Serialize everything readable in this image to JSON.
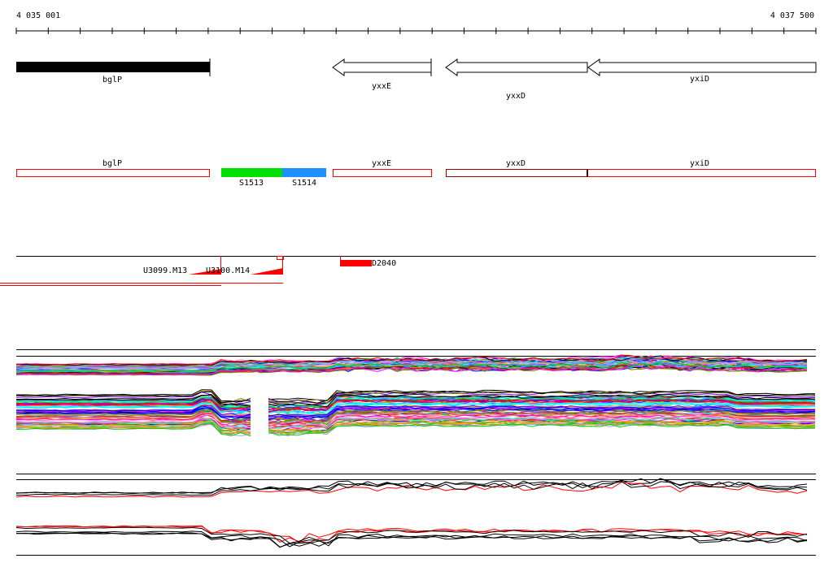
{
  "ruler": {
    "start_label": "4 035 001",
    "end_label": "4 037 500"
  },
  "genes": [
    {
      "name": "bglP",
      "strand": "+",
      "highlight": true
    },
    {
      "name": "yxxE",
      "strand": "-"
    },
    {
      "name": "yxxD",
      "strand": "-"
    },
    {
      "name": "yxiD",
      "strand": "-"
    }
  ],
  "segments": [
    {
      "name": "S1513",
      "color": "#00e000"
    },
    {
      "name": "S1514",
      "color": "#1e90ff"
    }
  ],
  "features": [
    {
      "name": "U3099.M13"
    },
    {
      "name": "U3100.M14"
    },
    {
      "name": "D2040"
    }
  ],
  "colors": {
    "feature": "#ff0000",
    "line": "#000000"
  }
}
